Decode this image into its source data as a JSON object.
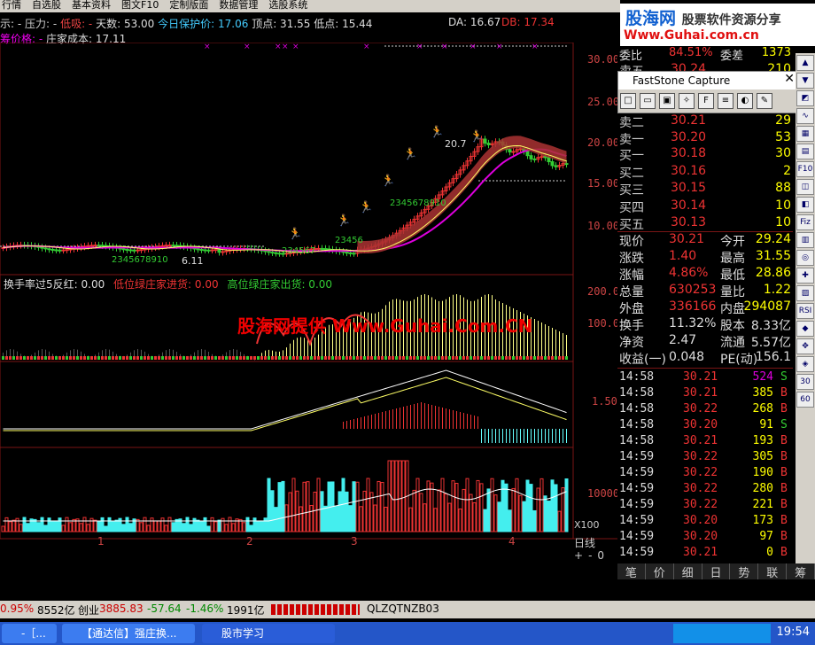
{
  "menu": [
    "行情",
    "自选股",
    "基本资料",
    "图文F10",
    "定制版面",
    "数据管理",
    "选股系统"
  ],
  "info1": {
    "prefix": "示: -",
    "pressure": "压力: -",
    "low_absorb": "低吸: -",
    "days": "天数: 53.00",
    "protect": "今日保护价: 17.06",
    "top": "顶点: 31.55",
    "bottom": "低点: 15.44",
    "da": "DA: 16.67",
    "db": "DB: 17.34"
  },
  "info2": {
    "price": "筹价格: -",
    "cost": "庄家成本: 17.11"
  },
  "yaxis_main": [
    "30.00",
    "25.00",
    "20.00",
    "15.00",
    "10.00"
  ],
  "yaxis_ind1": [
    "200.0",
    "100.0"
  ],
  "yaxis_ind2": [
    "1.50"
  ],
  "yaxis_vol": [
    "10000"
  ],
  "x100": "X100",
  "xlabels": [
    "1",
    "2",
    "3",
    "4"
  ],
  "day_label": "日线",
  "zoom": [
    "+",
    "-",
    "0"
  ],
  "chart_annotations": {
    "high_price": "20.7",
    "low_price": "6.11",
    "seq1": "2345678910",
    "seq2": "23456789",
    "seq3": "234567",
    "seq4": "23456",
    "seq5": "2345678910"
  },
  "ind1_legend": {
    "a": "换手率过5反红: 0.00",
    "b": "低位绿庄家进货: 0.00",
    "c": "高位绿庄家出货: 0.00"
  },
  "watermark": "股海网提供 Www.Guhai.Com.CN",
  "logo": {
    "line1": "股海网",
    "line1b": "股票软件资源分享",
    "line2": "Www.Guhai.com.cn"
  },
  "faststone": {
    "title": "FastStone Capture"
  },
  "orderbook": {
    "top_partial": [
      {
        "label": "委比",
        "value": "84.51%",
        "label2": "委差",
        "value2": "1373"
      },
      {
        "label": "卖五",
        "price": "30.24",
        "vol": "210"
      }
    ],
    "sell": [
      {
        "label": "卖二",
        "price": "30.21",
        "vol": "29"
      },
      {
        "label": "卖一",
        "price": "30.20",
        "vol": "53"
      }
    ],
    "buy": [
      {
        "label": "买一",
        "price": "30.18",
        "vol": "30"
      },
      {
        "label": "买二",
        "price": "30.16",
        "vol": "2"
      },
      {
        "label": "买三",
        "price": "30.15",
        "vol": "88"
      },
      {
        "label": "买四",
        "price": "30.14",
        "vol": "10"
      },
      {
        "label": "买五",
        "price": "30.13",
        "vol": "10"
      }
    ]
  },
  "quote": [
    {
      "l1": "现价",
      "v1": "30.21",
      "l2": "今开",
      "v2": "29.24"
    },
    {
      "l1": "涨跌",
      "v1": "1.40",
      "l2": "最高",
      "v2": "31.55"
    },
    {
      "l1": "涨幅",
      "v1": "4.86%",
      "l2": "最低",
      "v2": "28.86"
    },
    {
      "l1": "总量",
      "v1": "630253",
      "l2": "量比",
      "v2": "1.22"
    },
    {
      "l1": "外盘",
      "v1": "336166",
      "l2": "内盘",
      "v2": "294087"
    },
    {
      "l1": "换手",
      "v1": "11.32%",
      "l2": "股本",
      "v2": "8.33亿"
    },
    {
      "l1": "净资",
      "v1": "2.47",
      "l2": "流通",
      "v2": "5.57亿"
    },
    {
      "l1": "收益(一)",
      "v1": "0.048",
      "l2": "PE(动)",
      "v2": "156.1"
    }
  ],
  "ticks": [
    {
      "t": "14:58",
      "p": "30.21",
      "v": "524",
      "s": "S"
    },
    {
      "t": "14:58",
      "p": "30.21",
      "v": "385",
      "s": "B"
    },
    {
      "t": "14:58",
      "p": "30.22",
      "v": "268",
      "s": "B"
    },
    {
      "t": "14:58",
      "p": "30.20",
      "v": "91",
      "s": "S"
    },
    {
      "t": "14:58",
      "p": "30.21",
      "v": "193",
      "s": "B"
    },
    {
      "t": "14:59",
      "p": "30.22",
      "v": "305",
      "s": "B"
    },
    {
      "t": "14:59",
      "p": "30.22",
      "v": "190",
      "s": "B"
    },
    {
      "t": "14:59",
      "p": "30.22",
      "v": "280",
      "s": "B"
    },
    {
      "t": "14:59",
      "p": "30.22",
      "v": "221",
      "s": "B"
    },
    {
      "t": "14:59",
      "p": "30.20",
      "v": "173",
      "s": "B"
    },
    {
      "t": "14:59",
      "p": "30.20",
      "v": "97",
      "s": "B"
    },
    {
      "t": "14:59",
      "p": "30.21",
      "v": "0",
      "s": "B"
    }
  ],
  "side_numbers": [
    "30",
    "60"
  ],
  "bottom_tabs": [
    "笔",
    "价",
    "细",
    "日",
    "势",
    "联",
    "筹"
  ],
  "statusbar": {
    "pct": "0.95%",
    "amt": "8552亿",
    "name": "创业",
    "idx": "3885.83",
    "chg": "-57.64",
    "chgpct": "-1.46%",
    "vol": "1991亿",
    "code": "QLZQTNZB03"
  },
  "taskbar": [
    {
      "label": "-［..."
    },
    {
      "label": "【通达信】强庄换..."
    },
    {
      "label": "股市学习"
    }
  ],
  "clock": "19:54",
  "colors": {
    "red": "#e33",
    "yellow": "#ff0",
    "cyan": "#4ff",
    "magenta": "#e0e"
  }
}
